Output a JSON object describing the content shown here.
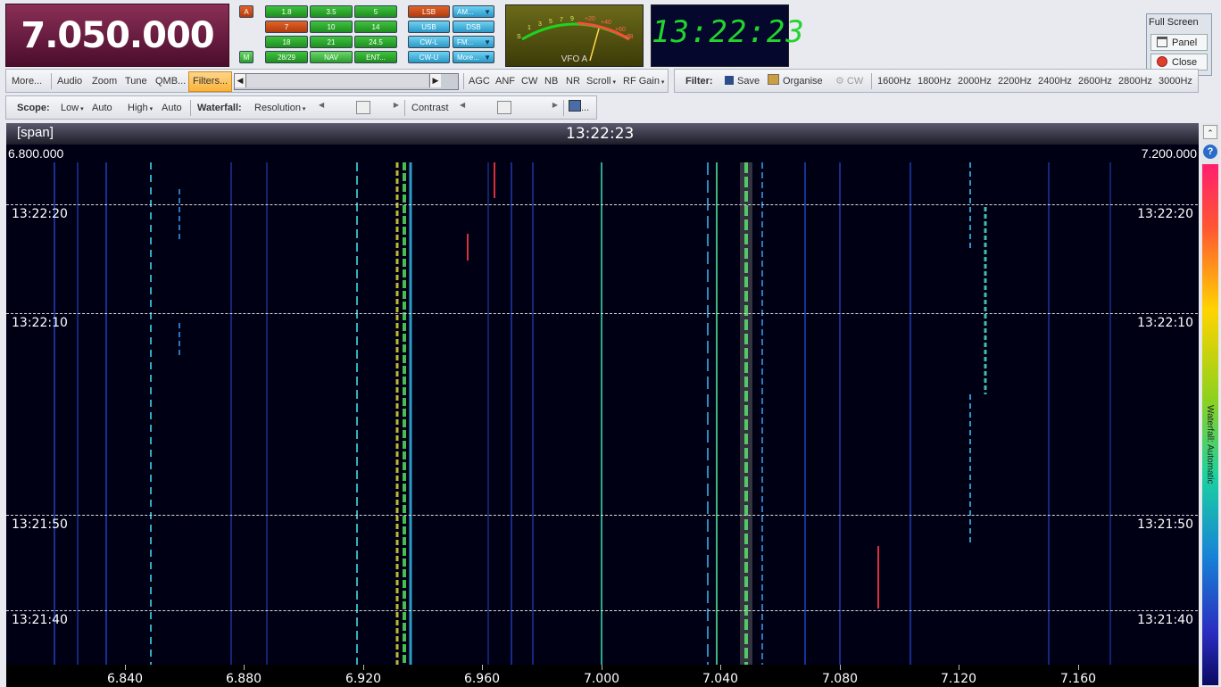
{
  "frequency": "7.050.000",
  "clock": "13:22:23",
  "vfo_label": "VFO A",
  "meter_scale": [
    "S",
    "1",
    "3",
    "5",
    "7",
    "9",
    "+20",
    "+40",
    "+60",
    "dB"
  ],
  "buttons": {
    "a": "A",
    "m": "M",
    "bands": [
      "1.8",
      "3.5",
      "5",
      "7",
      "10",
      "14",
      "18",
      "21",
      "24.5",
      "28/29",
      "NAV",
      "ENT..."
    ],
    "modes_left": [
      "LSB",
      "USB",
      "CW-L",
      "CW-U"
    ],
    "modes_right": [
      "AM...",
      "DSB",
      "FM...",
      "More..."
    ]
  },
  "full_screen": {
    "title": "Full Screen",
    "panel": "Panel",
    "close": "Close"
  },
  "toolbar1": {
    "items": [
      "More...",
      "Audio",
      "Zoom",
      "Tune",
      "QMB...",
      "Filters..."
    ],
    "right_items": [
      "AGC",
      "ANF",
      "CW",
      "NB",
      "NR",
      "Scroll",
      "RF Gain"
    ]
  },
  "filter_bar": {
    "label": "Filter:",
    "save": "Save",
    "organise": "Organise",
    "cw": "CW",
    "widths": [
      "1600Hz",
      "1800Hz",
      "2000Hz",
      "2200Hz",
      "2400Hz",
      "2600Hz",
      "2800Hz",
      "3000Hz"
    ]
  },
  "toolbar2": {
    "scope": "Scope:",
    "low": "Low",
    "auto1": "Auto",
    "high": "High",
    "auto2": "Auto",
    "waterfall": "Waterfall:",
    "resolution": "Resolution",
    "contrast": "Contrast",
    "more": "..."
  },
  "waterfall": {
    "span": "[span]",
    "time": "13:22:23",
    "freq_left": "6.800.000",
    "freq_right": "7.200.000",
    "time_marks": [
      "13:22:20",
      "13:22:10",
      "13:21:50",
      "13:21:40"
    ],
    "freq_ticks": [
      "6.840",
      "6.880",
      "6.920",
      "6.960",
      "7.000",
      "7.040",
      "7.080",
      "7.120",
      "7.160"
    ],
    "colorbar_label": "Waterfall: Automatic"
  },
  "colors": {
    "freq_bg": "#6e1d44",
    "clock_digits": "#22d42e",
    "waterfall_bg": "#000014"
  }
}
